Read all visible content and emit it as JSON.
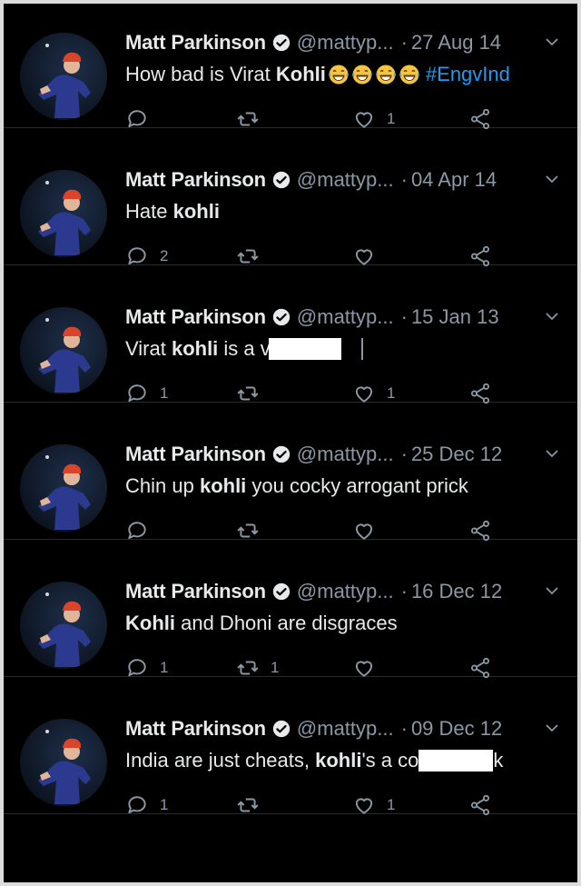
{
  "tweets": [
    {
      "name": "Matt Parkinson",
      "handle": "@mattyp...",
      "dot": "·",
      "date": "27 Aug 14",
      "text": [
        {
          "t": "How bad is Virat ",
          "style": "normal"
        },
        {
          "t": "Kohli",
          "style": "bold"
        }
      ],
      "emoji_count": 4,
      "hashtag": "#EngvInd",
      "replies": "",
      "retweets": "",
      "likes": "1"
    },
    {
      "name": "Matt Parkinson",
      "handle": "@mattyp...",
      "dot": "·",
      "date": "04 Apr 14",
      "text": [
        {
          "t": "Hate ",
          "style": "normal"
        },
        {
          "t": "kohli",
          "style": "bold"
        }
      ],
      "replies": "2",
      "retweets": "",
      "likes": ""
    },
    {
      "name": "Matt Parkinson",
      "handle": "@mattyp...",
      "dot": "·",
      "date": "15 Jan 13",
      "text": [
        {
          "t": "Virat ",
          "style": "normal"
        },
        {
          "t": "kohli",
          "style": "bold"
        },
        {
          "t": " is a v",
          "style": "normal"
        }
      ],
      "redacted": true,
      "replies": "1",
      "retweets": "",
      "likes": "1"
    },
    {
      "name": "Matt Parkinson",
      "handle": "@mattyp...",
      "dot": "·",
      "date": "25 Dec 12",
      "text": [
        {
          "t": "Chin up ",
          "style": "normal"
        },
        {
          "t": "kohli",
          "style": "bold"
        },
        {
          "t": " you cocky arrogant prick",
          "style": "normal"
        }
      ],
      "replies": "",
      "retweets": "",
      "likes": ""
    },
    {
      "name": "Matt Parkinson",
      "handle": "@mattyp...",
      "dot": "·",
      "date": "16 Dec 12",
      "text": [
        {
          "t": "Kohli",
          "style": "bold"
        },
        {
          "t": " and Dhoni are disgraces",
          "style": "normal"
        }
      ],
      "replies": "1",
      "retweets": "1",
      "likes": ""
    },
    {
      "name": "Matt Parkinson",
      "handle": "@mattyp...",
      "dot": "·",
      "date": "09 Dec 12",
      "text": [
        {
          "t": "India are just cheats, ",
          "style": "normal"
        },
        {
          "t": "kohli",
          "style": "bold"
        },
        {
          "t": "'s a co",
          "style": "normal"
        }
      ],
      "redacted_mid": true,
      "tail": "k",
      "replies": "1",
      "retweets": "",
      "likes": "1"
    }
  ],
  "icons": {
    "verified": "verified-badge-icon",
    "caret": "chevron-down-icon",
    "reply": "reply-icon",
    "retweet": "retweet-icon",
    "like": "heart-icon",
    "share": "share-icon",
    "emoji": "laughing-emoji-icon"
  },
  "colors": {
    "background": "#000000",
    "text": "#e7e9ea",
    "muted": "#8b98a5",
    "link": "#1d9bf0"
  }
}
